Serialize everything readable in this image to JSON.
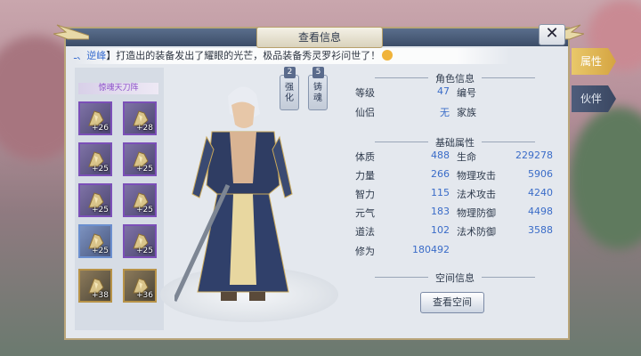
{
  "window": {
    "title": "查看信息",
    "close_symbol": "✕"
  },
  "notice": {
    "name": "ـ、逆峰",
    "text": "】打造出的装备发出了耀眼的光芒，极品装备秀灵罗衫问世了！"
  },
  "equipment": {
    "set_name": "惊魂天刀阵",
    "slots": [
      {
        "plus": "+26",
        "quality": "purple",
        "icon": "glove-icon"
      },
      {
        "plus": "+28",
        "quality": "purple",
        "icon": "helmet-icon"
      },
      {
        "plus": "+25",
        "quality": "purple",
        "icon": "shoulder-icon"
      },
      {
        "plus": "+25",
        "quality": "purple",
        "icon": "amulet-icon"
      },
      {
        "plus": "+25",
        "quality": "purple",
        "icon": "bracer-icon"
      },
      {
        "plus": "+25",
        "quality": "purple",
        "icon": "ring-icon"
      },
      {
        "plus": "+25",
        "quality": "blue",
        "icon": "boots-icon"
      },
      {
        "plus": "+25",
        "quality": "purple",
        "icon": "belt-icon"
      },
      {
        "plus": "+38",
        "quality": "gold",
        "icon": "sword-icon"
      },
      {
        "plus": "+36",
        "quality": "gold",
        "icon": "armor-icon"
      }
    ]
  },
  "mode_tabs": [
    {
      "badge": "2",
      "label": "强化"
    },
    {
      "badge": "5",
      "label": "铸魂"
    }
  ],
  "role_info": {
    "header": "角色信息",
    "level_label": "等级",
    "level_value": "47",
    "id_label": "编号",
    "id_value": "",
    "partner_label": "仙侣",
    "partner_value": "无",
    "family_label": "家族",
    "family_value": ""
  },
  "base_attrs": {
    "header": "基础属性",
    "rows": [
      {
        "k1": "体质",
        "v1": "488",
        "k2": "生命",
        "v2": "229278"
      },
      {
        "k1": "力量",
        "v1": "266",
        "k2": "物理攻击",
        "v2": "5906"
      },
      {
        "k1": "智力",
        "v1": "115",
        "k2": "法术攻击",
        "v2": "4240"
      },
      {
        "k1": "元气",
        "v1": "183",
        "k2": "物理防御",
        "v2": "4498"
      },
      {
        "k1": "道法",
        "v1": "102",
        "k2": "法术防御",
        "v2": "3588"
      }
    ],
    "cultivation_label": "修为",
    "cultivation_value": "180492"
  },
  "space": {
    "header": "空间信息",
    "button": "查看空间"
  },
  "side_tabs": [
    {
      "label": "属性",
      "active": true
    },
    {
      "label": "伙伴",
      "active": false
    }
  ],
  "colors": {
    "value_blue": "#3a6cc8",
    "gold_accent": "#d5a441",
    "set_purple": "#8b4fc9"
  }
}
